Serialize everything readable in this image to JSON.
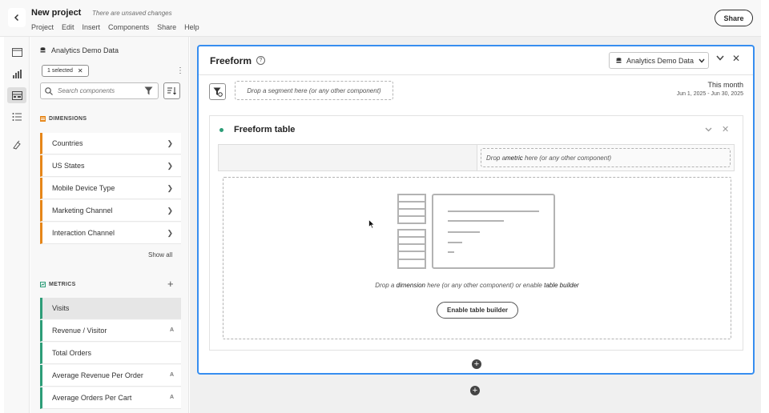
{
  "header": {
    "title": "New project",
    "unsaved_note": "There are unsaved changes",
    "menu": [
      "Project",
      "Edit",
      "Insert",
      "Components",
      "Share",
      "Help"
    ],
    "share_label": "Share"
  },
  "rail": {
    "icons": [
      "panels-icon",
      "visualizations-icon",
      "components-icon",
      "list-icon",
      "brush-icon"
    ]
  },
  "components_panel": {
    "data_source": "Analytics Demo Data",
    "chip_label": "1 selected",
    "search_placeholder": "Search components",
    "dimensions_heading": "DIMENSIONS",
    "dimensions": [
      "Countries",
      "US States",
      "Mobile Device Type",
      "Marketing Channel",
      "Interaction Channel"
    ],
    "show_all": "Show all",
    "metrics_heading": "METRICS",
    "metrics": [
      {
        "label": "Visits",
        "selected": true,
        "mark": ""
      },
      {
        "label": "Revenue / Visitor",
        "selected": false,
        "mark": "A"
      },
      {
        "label": "Total Orders",
        "selected": false,
        "mark": ""
      },
      {
        "label": "Average Revenue Per Order",
        "selected": false,
        "mark": "A"
      },
      {
        "label": "Average Orders Per Cart",
        "selected": false,
        "mark": "A"
      }
    ],
    "colors": {
      "dimension": "#e68619",
      "metric": "#2d9d78"
    }
  },
  "panel": {
    "title": "Freeform",
    "data_source": "Analytics Demo Data",
    "segment_drop": "Drop a segment here (or any other component)",
    "date_label": "This month",
    "date_range": "Jun 1, 2025 - Jun 30, 2025",
    "accent": "#378ef0"
  },
  "table": {
    "title": "Freeform table",
    "metric_drop": {
      "pre": "Drop a ",
      "em": "metric",
      "post": " here (or any other component)"
    },
    "dimension_drop": {
      "pre": "Drop a ",
      "em1": "dimension",
      "mid": " here (or any other component) or enable ",
      "em2": "table builder"
    },
    "enable_button": "Enable table builder"
  }
}
